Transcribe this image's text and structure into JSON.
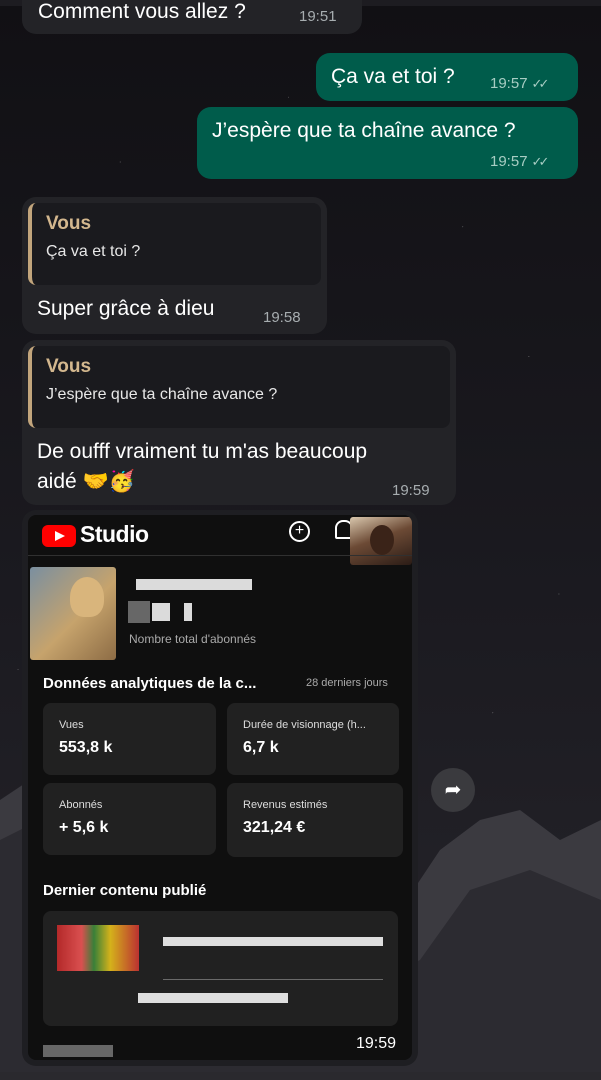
{
  "messages": {
    "partial_top": {
      "text": "Comment vous allez ?",
      "time": "19:51"
    },
    "m1": {
      "text": "Ça va et toi ?",
      "time": "19:57",
      "ticks": "✓✓"
    },
    "m2": {
      "text": "J’espère que ta chaîne avance ?",
      "time": "19:57",
      "ticks": "✓✓"
    },
    "r1": {
      "quote_author": "Vous",
      "quote_text": "Ça va et toi ?",
      "text": "Super grâce à dieu",
      "time": "19:58"
    },
    "r2": {
      "quote_author": "Vous",
      "quote_text": "J’espère que ta chaîne avance ?",
      "text_line1": "De oufff vraiment tu m'as beaucoup",
      "text_line2": "aidé 🤝🥳",
      "time": "19:59"
    }
  },
  "studio": {
    "brand": "Studio",
    "subscribers_label": "Nombre total d'abonnés",
    "analytics_title": "Données analytiques de la c...",
    "analytics_period": "28 derniers jours",
    "metrics": [
      {
        "label": "Vues",
        "value": "553,8 k"
      },
      {
        "label": "Durée de visionnage (h...",
        "value": "6,7 k"
      },
      {
        "label": "Abonnés",
        "value": "+ 5,6 k"
      },
      {
        "label": "Revenus estimés",
        "value": "321,24 €"
      }
    ],
    "latest_title": "Dernier contenu publié",
    "time": "19:59"
  },
  "icons": {
    "share": "share-icon",
    "add": "add-icon",
    "bell": "bell-icon"
  },
  "colors": {
    "outgoing": "#005c4b",
    "incoming": "#232327",
    "quote_accent": "#c2a57c",
    "yt_red": "#ff0000"
  }
}
